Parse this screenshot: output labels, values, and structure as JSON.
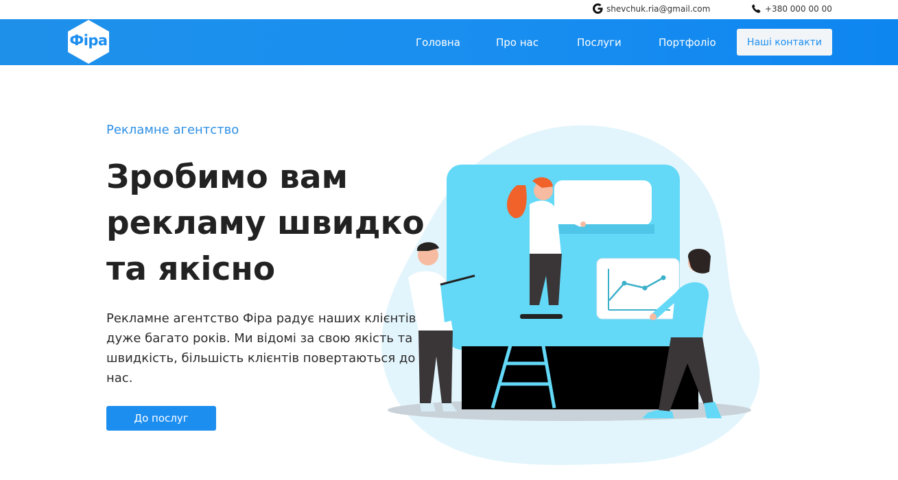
{
  "topbar": {
    "email": "shevchuk.ria@gmail.com",
    "phone": "+380 000 00 00",
    "email_icon": "google-icon",
    "phone_icon": "phone-icon"
  },
  "header": {
    "logo_text": "Фіра",
    "nav": [
      "Головна",
      "Про нас",
      "Послуги",
      "Портфоліо"
    ],
    "contacts_button": "Наші контакти"
  },
  "hero": {
    "eyebrow": "Рекламне агентство",
    "headline_lines": [
      "Зробимо вам",
      "рекламу швидко",
      "та якісно"
    ],
    "description": "Рекламне агентство Фіра радує наших клієнтів дуже багато років. Ми відомі за свою якість та швидкість, більшість клієнтів повертаються до нас.",
    "cta": "До послуг"
  },
  "colors": {
    "brand": "#1c8ef0",
    "accent_light": "#63d9f7",
    "blob": "#e3f5fc",
    "hair": "#f0622a"
  }
}
